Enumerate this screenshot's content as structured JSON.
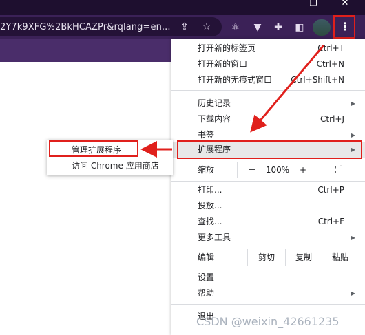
{
  "address_bar": {
    "url_text": "2Y7k9XFG%2BkHCAZPr&rqlang=en..."
  },
  "toolbar": {
    "icons": [
      "share-icon",
      "star-icon",
      "react-extension-icon",
      "vue-extension-icon",
      "puzzle-icon",
      "sidepanel-icon",
      "profile-avatar",
      "more-menu-icon"
    ],
    "kebab": "⋮"
  },
  "menu": {
    "new_tab": {
      "label": "打开新的标签页",
      "shortcut": "Ctrl+T"
    },
    "new_window": {
      "label": "打开新的窗口",
      "shortcut": "Ctrl+N"
    },
    "incognito": {
      "label": "打开新的无痕式窗口",
      "shortcut": "Ctrl+Shift+N"
    },
    "history": {
      "label": "历史记录"
    },
    "downloads": {
      "label": "下载内容",
      "shortcut": "Ctrl+J"
    },
    "bookmarks": {
      "label": "书签"
    },
    "extensions": {
      "label": "扩展程序"
    },
    "zoom": {
      "label": "缩放",
      "minus": "－",
      "value": "100%",
      "plus": "+",
      "fullscreen": "⛶"
    },
    "print": {
      "label": "打印...",
      "shortcut": "Ctrl+P"
    },
    "cast": {
      "label": "投放..."
    },
    "find": {
      "label": "查找...",
      "shortcut": "Ctrl+F"
    },
    "more_tools": {
      "label": "更多工具"
    },
    "edit": {
      "label": "编辑",
      "cut": "剪切",
      "copy": "复制",
      "paste": "粘贴"
    },
    "settings": {
      "label": "设置"
    },
    "help": {
      "label": "帮助"
    },
    "exit": {
      "label": "退出"
    }
  },
  "submenu": {
    "manage": {
      "label": "管理扩展程序"
    },
    "store": {
      "label": "访问 Chrome 应用商店"
    }
  },
  "watermark": "CSDN @weixin_42661235",
  "colors": {
    "annotation_red": "#e0201c",
    "toolbar": "#3b2157",
    "highlight": "#e8e8e8"
  }
}
